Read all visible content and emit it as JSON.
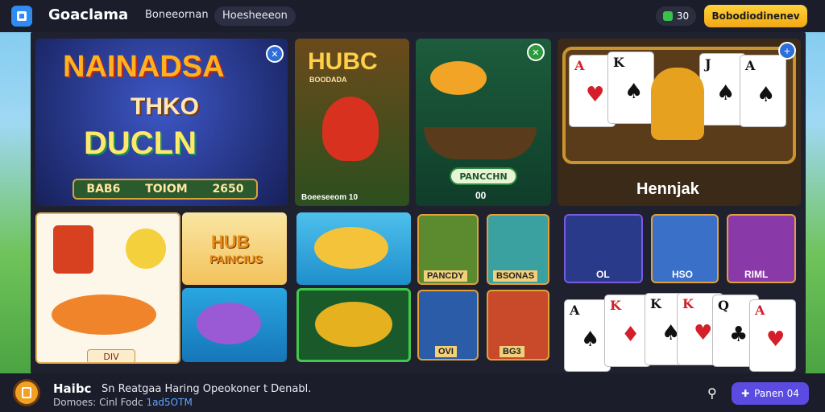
{
  "header": {
    "brand": "Goaclama",
    "nav_link": "Boneeornan",
    "nav_pill": "Hoesheeeon",
    "balance": "30",
    "cta": "Bobodiodinenev"
  },
  "tiles": {
    "big1": {
      "line1": "NAINADSA",
      "line2": "THKO",
      "line3": "DUCLN",
      "s1": "BAB6",
      "s2": "TOIOM",
      "s3": "2650"
    },
    "hub": {
      "title": "HUBC",
      "sub": "BOODADA",
      "bottom": "Boeeseeom 10"
    },
    "boat": {
      "badge": "PANCCHN",
      "num": "00"
    },
    "cards": {
      "label": "Hennjak"
    },
    "lantern": {
      "label": "DIV"
    },
    "hubpan": {
      "line1": "HUB",
      "line2": "PAINCIUS"
    },
    "t_pancdy": {
      "label": "PANCDY"
    },
    "t_bsonas": {
      "label": "BSONAS"
    },
    "t_ol": {
      "label": "OL"
    },
    "t_hso": {
      "label": "HSO"
    },
    "t_rim": {
      "label": "RIML"
    },
    "t_ovi": {
      "label": "OVI"
    },
    "t_bg": {
      "label": "BG3"
    }
  },
  "footer": {
    "name": "Haibc",
    "desc": "Sn Reatgaa Haring Opeokoner t Denabl.",
    "sub": "Domoes: Cinl Fodc",
    "sub_link": "1ad5OTM",
    "pill": "Panen 04"
  },
  "colors": {
    "accent": "#5b4be0",
    "cta": "#f1a815"
  },
  "icons": [
    "app-logo-icon",
    "wallet-icon",
    "search-icon",
    "plus-icon",
    "close-icon"
  ]
}
